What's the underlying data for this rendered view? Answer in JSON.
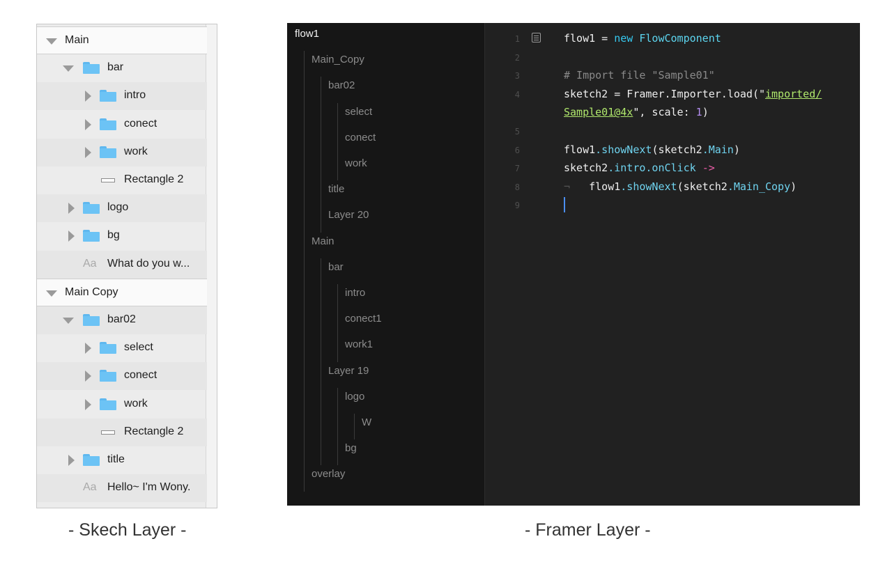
{
  "sketch": {
    "caption": "- Skech Layer -",
    "rows": [
      {
        "label": "Main",
        "depth": 0,
        "type": "artboard",
        "expanded": true
      },
      {
        "label": "bar",
        "depth": 1,
        "type": "folder",
        "expanded": true
      },
      {
        "label": "intro",
        "depth": 2,
        "type": "folder",
        "expanded": false
      },
      {
        "label": "conect",
        "depth": 2,
        "type": "folder",
        "expanded": false
      },
      {
        "label": "work",
        "depth": 2,
        "type": "folder",
        "expanded": false
      },
      {
        "label": "Rectangle 2",
        "depth": 2,
        "type": "rect"
      },
      {
        "label": "logo",
        "depth": 1,
        "type": "folder",
        "expanded": false
      },
      {
        "label": "bg",
        "depth": 1,
        "type": "folder",
        "expanded": false
      },
      {
        "label": "What do you w...",
        "depth": 1,
        "type": "text"
      },
      {
        "label": "Main Copy",
        "depth": 0,
        "type": "artboard",
        "expanded": true
      },
      {
        "label": "bar02",
        "depth": 1,
        "type": "folder",
        "expanded": true
      },
      {
        "label": "select",
        "depth": 2,
        "type": "folder",
        "expanded": false
      },
      {
        "label": "conect",
        "depth": 2,
        "type": "folder",
        "expanded": false
      },
      {
        "label": "work",
        "depth": 2,
        "type": "folder",
        "expanded": false
      },
      {
        "label": "Rectangle 2",
        "depth": 2,
        "type": "rect"
      },
      {
        "label": "title",
        "depth": 1,
        "type": "folder",
        "expanded": false
      },
      {
        "label": "Hello~ I'm Wony.",
        "depth": 1,
        "type": "text"
      }
    ],
    "text_icon": "Aa"
  },
  "framer": {
    "caption": "- Framer Layer -",
    "tree": [
      {
        "label": "flow1",
        "depth": 0
      },
      {
        "label": "Main_Copy",
        "depth": 1
      },
      {
        "label": "bar02",
        "depth": 2
      },
      {
        "label": "select",
        "depth": 3
      },
      {
        "label": "conect",
        "depth": 3
      },
      {
        "label": "work",
        "depth": 3
      },
      {
        "label": "title",
        "depth": 2
      },
      {
        "label": "Layer 20",
        "depth": 2
      },
      {
        "label": "Main",
        "depth": 1
      },
      {
        "label": "bar",
        "depth": 2
      },
      {
        "label": "intro",
        "depth": 3
      },
      {
        "label": "conect1",
        "depth": 3
      },
      {
        "label": "work1",
        "depth": 3
      },
      {
        "label": "Layer 19",
        "depth": 2
      },
      {
        "label": "logo",
        "depth": 3
      },
      {
        "label": "W",
        "depth": 4
      },
      {
        "label": "bg",
        "depth": 3
      },
      {
        "label": "overlay",
        "depth": 1
      }
    ],
    "code": [
      {
        "num": "1",
        "tokens": [
          [
            "flow1 = ",
            ""
          ],
          [
            "new",
            "kw"
          ],
          [
            " ",
            ""
          ],
          [
            "FlowComponent",
            "cls"
          ]
        ]
      },
      {
        "num": "2",
        "tokens": []
      },
      {
        "num": "3",
        "tokens": [
          [
            "# Import file \"Sample01\"",
            "com"
          ]
        ]
      },
      {
        "num": "4",
        "tokens": [
          [
            "sketch2 = Framer",
            ""
          ],
          [
            ".Importer.load",
            ""
          ],
          [
            "(\"",
            ""
          ],
          [
            "imported/",
            "strl"
          ]
        ]
      },
      {
        "num": "",
        "tokens": [
          [
            "Sample01@4x",
            "strl"
          ],
          [
            "\", scale: ",
            ""
          ],
          [
            "1",
            "num"
          ],
          [
            ")",
            ""
          ]
        ]
      },
      {
        "num": "5",
        "tokens": []
      },
      {
        "num": "6",
        "tokens": [
          [
            "flow1",
            ""
          ],
          [
            ".showNext",
            "m"
          ],
          [
            "(sketch2",
            ""
          ],
          [
            ".Main",
            "m"
          ],
          [
            ")",
            ""
          ]
        ]
      },
      {
        "num": "7",
        "tokens": [
          [
            "sketch2",
            ""
          ],
          [
            ".intro.onClick",
            "m"
          ],
          [
            " ",
            ""
          ],
          [
            "->",
            "arr"
          ]
        ]
      },
      {
        "num": "8",
        "tokens": [
          [
            "¬",
            "tab"
          ],
          [
            "   flow1",
            ""
          ],
          [
            ".showNext",
            "m"
          ],
          [
            "(sketch2",
            ""
          ],
          [
            ".Main_Copy",
            "m"
          ],
          [
            ")",
            ""
          ]
        ]
      },
      {
        "num": "9",
        "tokens": []
      }
    ]
  }
}
